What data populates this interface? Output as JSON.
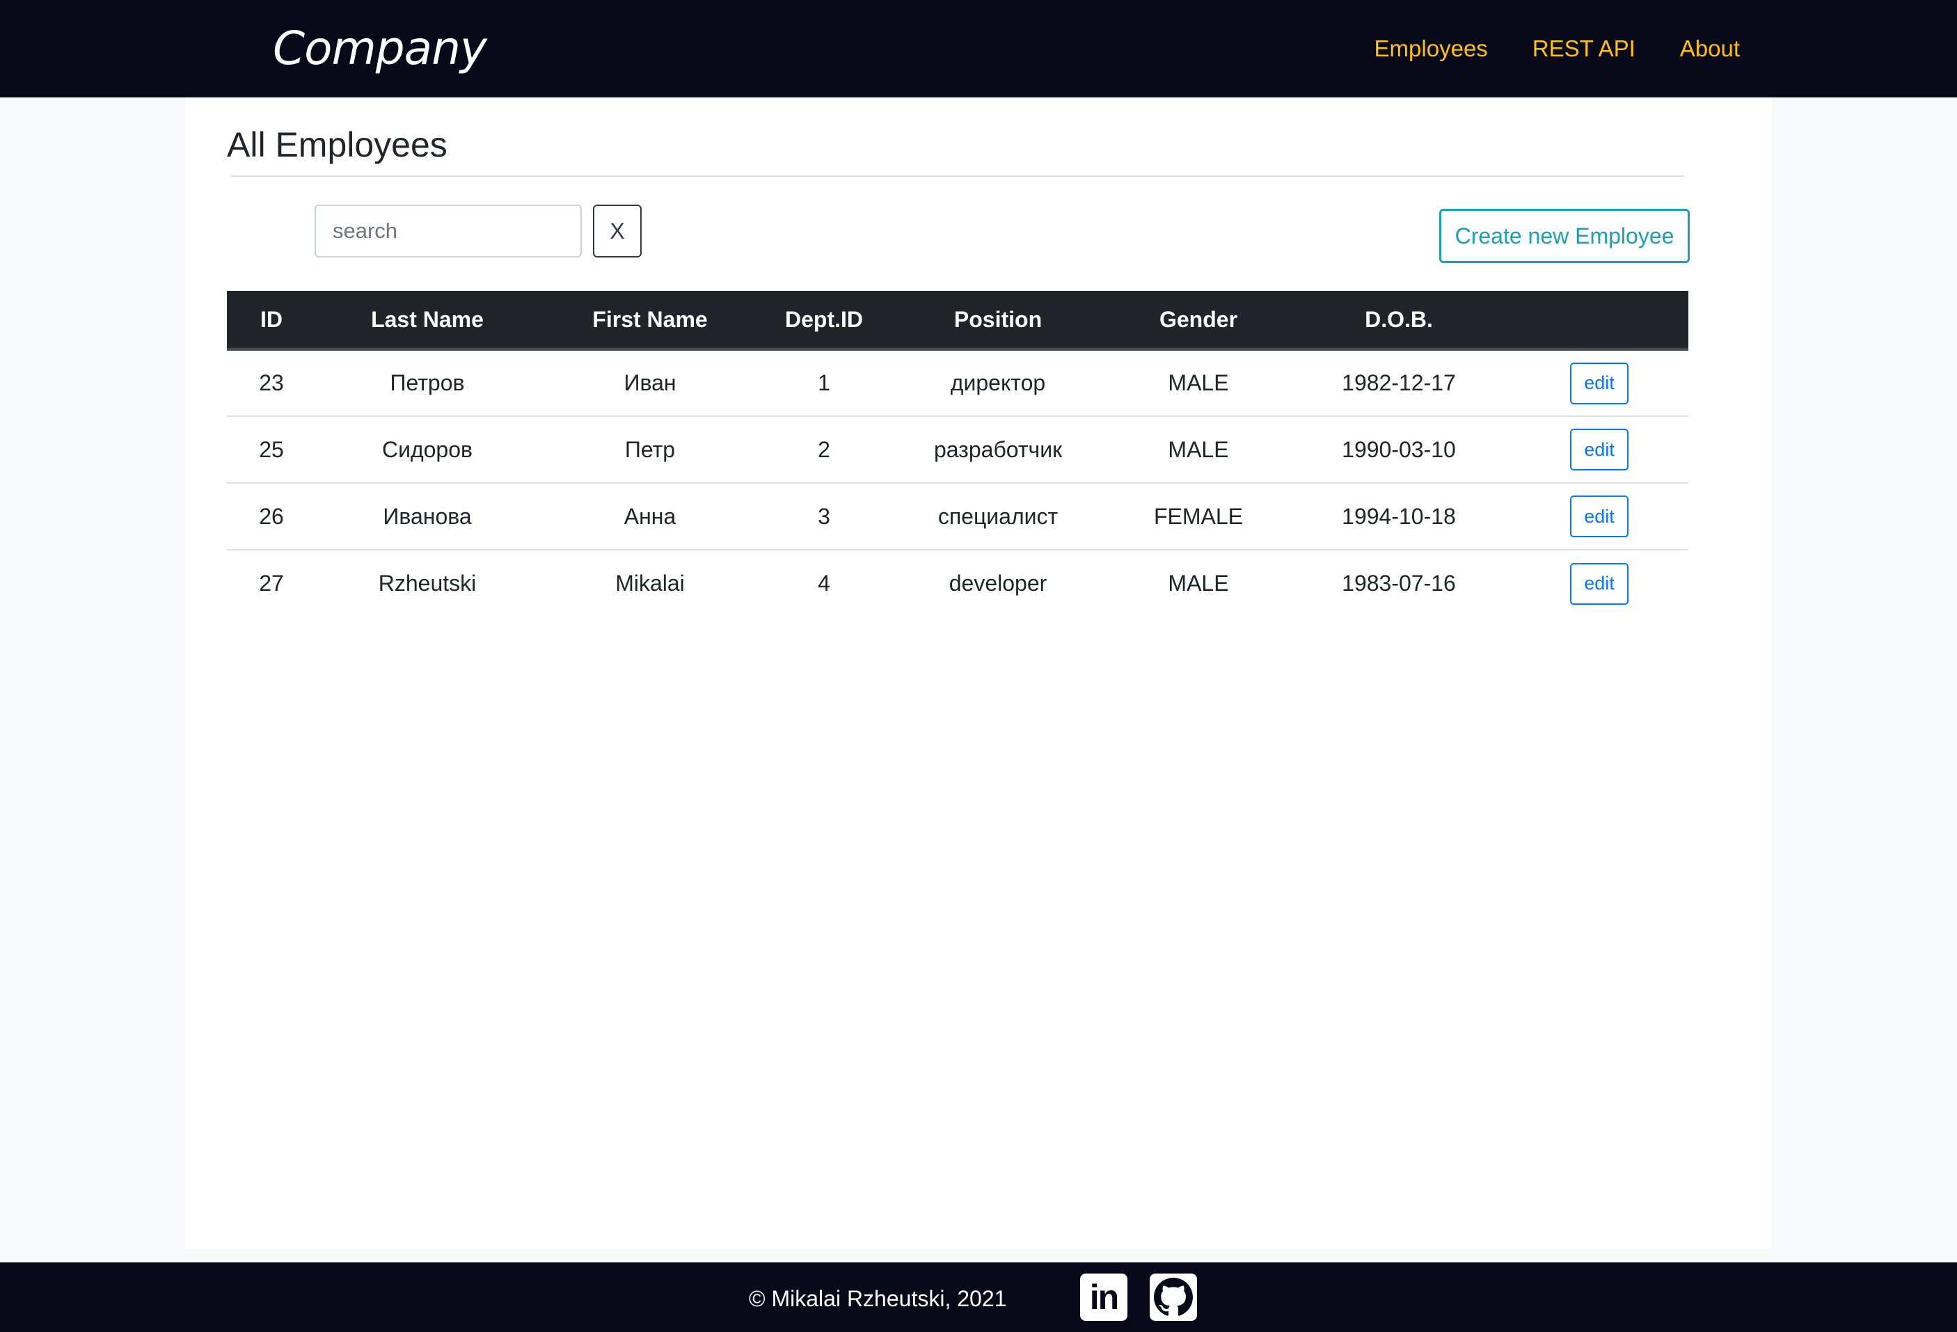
{
  "navbar": {
    "brand": "Company",
    "links": [
      {
        "label": "Employees"
      },
      {
        "label": "REST API"
      },
      {
        "label": "About"
      }
    ],
    "link_color": "#ffc107",
    "background": "#080a1a"
  },
  "page": {
    "title": "All Employees"
  },
  "search": {
    "placeholder": "search",
    "value": "",
    "clear_label": "X"
  },
  "create_button": {
    "label": "Create new Employee",
    "color": "#17a2b8"
  },
  "table": {
    "columns": [
      "ID",
      "Last Name",
      "First Name",
      "Dept.ID",
      "Position",
      "Gender",
      "D.O.B.",
      ""
    ],
    "rows": [
      {
        "id": "23",
        "last_name": "Петров",
        "first_name": "Иван",
        "dept_id": "1",
        "position": "директор",
        "gender": "MALE",
        "dob": "1982-12-17",
        "action": "edit"
      },
      {
        "id": "25",
        "last_name": "Сидоров",
        "first_name": "Петр",
        "dept_id": "2",
        "position": "разработчик",
        "gender": "MALE",
        "dob": "1990-03-10",
        "action": "edit"
      },
      {
        "id": "26",
        "last_name": "Иванова",
        "first_name": "Анна",
        "dept_id": "3",
        "position": "специалист",
        "gender": "FEMALE",
        "dob": "1994-10-18",
        "action": "edit"
      },
      {
        "id": "27",
        "last_name": "Rzheutski",
        "first_name": "Mikalai",
        "dept_id": "4",
        "position": "developer",
        "gender": "MALE",
        "dob": "1983-07-16",
        "action": "edit"
      }
    ]
  },
  "footer": {
    "copyright": "© Mikalai Rzheutski, 2021",
    "icons": [
      "linkedin-icon",
      "github-icon"
    ]
  }
}
